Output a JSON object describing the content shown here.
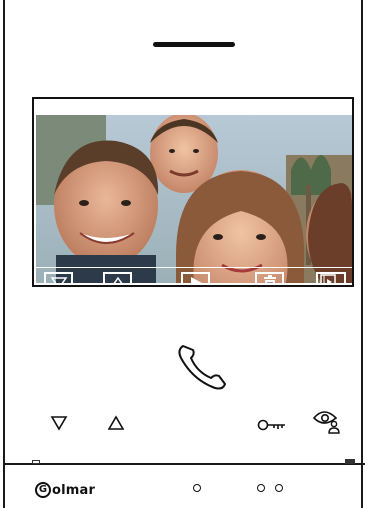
{
  "device": {
    "brand": "Golmar"
  },
  "logo": {
    "initial": "G",
    "text": "olmar"
  },
  "screen": {
    "content": "live-camera-view",
    "osd_buttons": [
      {
        "name": "volume-down",
        "icon": "triangle-down-icon"
      },
      {
        "name": "volume-up",
        "icon": "triangle-up-icon"
      },
      {
        "name": "play",
        "icon": "play-icon"
      },
      {
        "name": "delete",
        "icon": "trash-icon"
      },
      {
        "name": "gallery",
        "icon": "image-gallery-icon"
      }
    ]
  },
  "front_keys": [
    {
      "name": "down-key",
      "icon": "triangle-down-icon"
    },
    {
      "name": "up-key",
      "icon": "triangle-up-icon"
    },
    {
      "name": "door-open-key",
      "icon": "key-icon"
    },
    {
      "name": "monitor-key",
      "icon": "eye-user-icon"
    }
  ],
  "indicators": {
    "count": 3
  },
  "colors": {
    "frame": "#1a1a1a",
    "osd": "#ffffff"
  }
}
